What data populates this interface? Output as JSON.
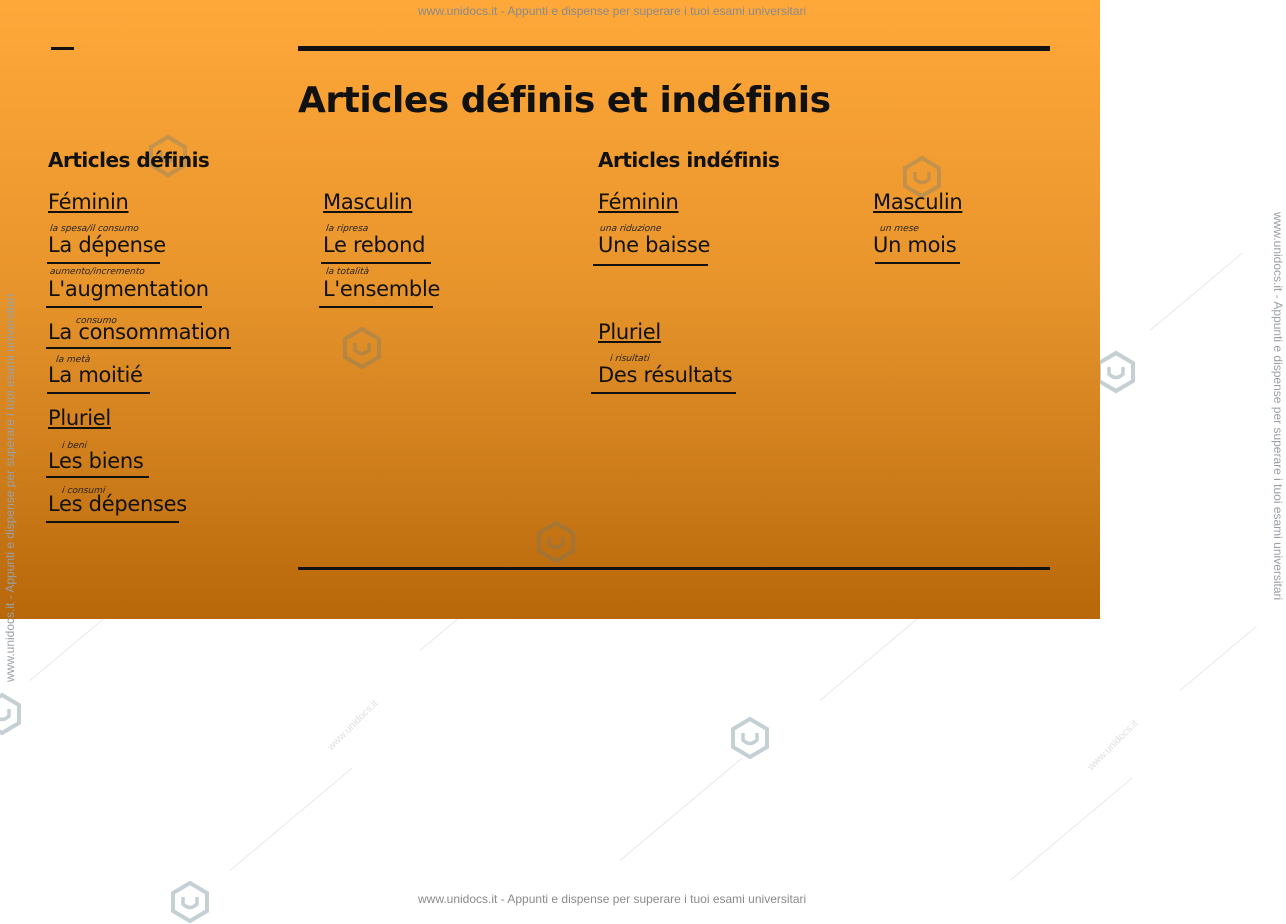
{
  "watermark": {
    "top": "www.unidocs.it - Appunti e dispense per superare i tuoi esami universitari",
    "bottom": "www.unidocs.it - Appunti e dispense per superare i tuoi esami universitari",
    "side": "www.unidocs.it - Appunti e dispense per superare i tuoi esami universitari",
    "diag": "www.unidocs.it",
    "icon": "unidocs-logo-icon",
    "color": "#9aa8b0"
  },
  "slide": {
    "title": "Articles définis et indéfinis",
    "gradient_top": "#ffa83a",
    "gradient_bottom": "#b86709"
  },
  "definis": {
    "heading": "Articles définis",
    "feminin": {
      "label": "Féminin",
      "items": [
        {
          "note": "la spesa/il consumo",
          "word": "La dépense"
        },
        {
          "note": "aumento/incremento",
          "word": "L'augmentation"
        },
        {
          "note": "consumo",
          "word": "La consommation"
        },
        {
          "note": "la metà",
          "word": "La moitié"
        }
      ]
    },
    "masculin": {
      "label": "Masculin",
      "items": [
        {
          "note": "la ripresa",
          "word": "Le rebond"
        },
        {
          "note": "la totalità",
          "word": "L'ensemble"
        }
      ]
    },
    "pluriel": {
      "label": "Pluriel",
      "items": [
        {
          "note": "i   beni",
          "word": "Les biens"
        },
        {
          "note": "i   consumi",
          "word": "Les dépenses"
        }
      ]
    }
  },
  "indefinis": {
    "heading": "Articles indéfinis",
    "feminin": {
      "label": "Féminin",
      "items": [
        {
          "note": "una riduzione",
          "word": "Une baisse"
        }
      ]
    },
    "masculin": {
      "label": "Masculin",
      "items": [
        {
          "note": "un   mese",
          "word": "Un mois"
        }
      ]
    },
    "pluriel": {
      "label": "Pluriel",
      "items": [
        {
          "note": "i   risultati",
          "word": "Des résultats"
        }
      ]
    }
  }
}
